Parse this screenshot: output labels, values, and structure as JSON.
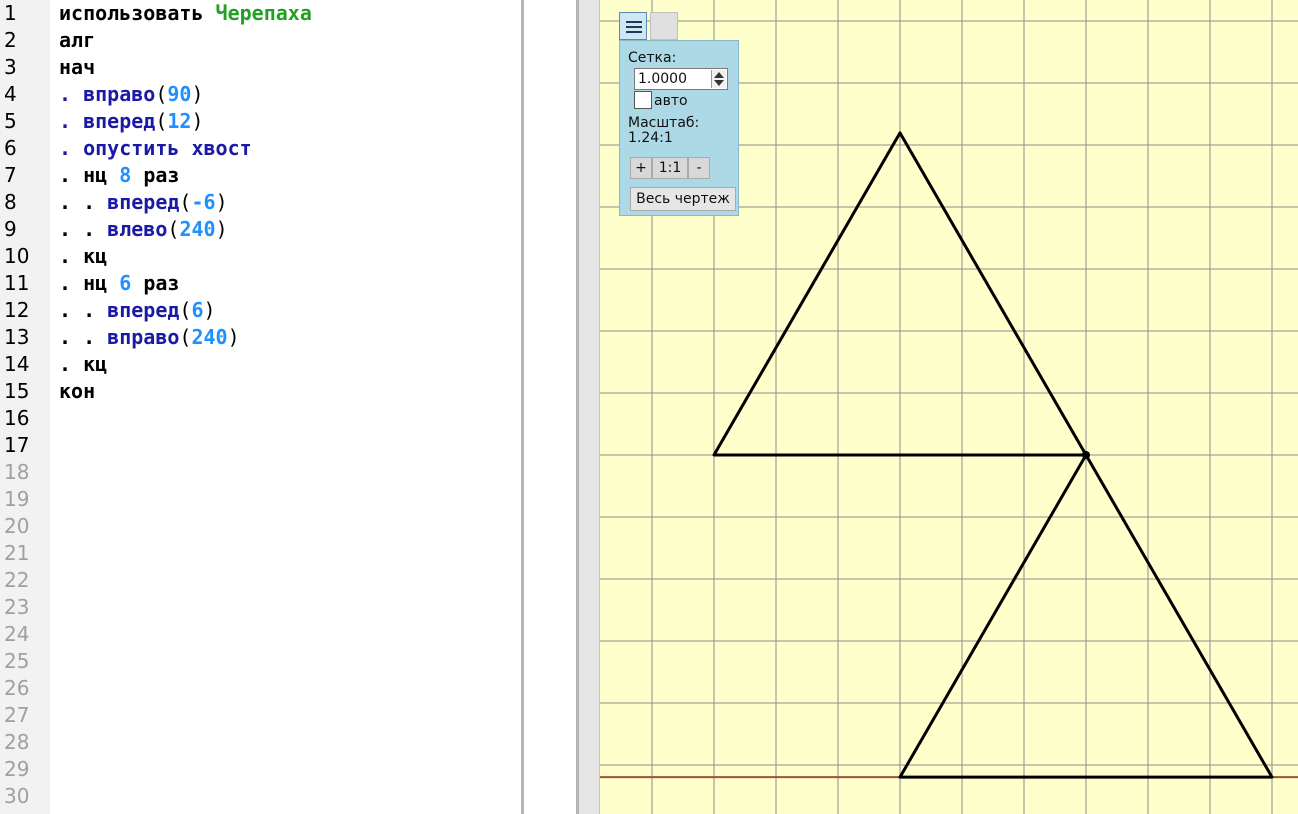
{
  "editor": {
    "line_numbers": [
      "1",
      "2",
      "3",
      "4",
      "5",
      "6",
      "7",
      "8",
      "9",
      "10",
      "11",
      "12",
      "13",
      "14",
      "15",
      "16",
      "17",
      "18",
      "19",
      "20",
      "21",
      "22",
      "23",
      "24",
      "25",
      "26",
      "27",
      "28",
      "29",
      "30"
    ],
    "code": {
      "l1_kw": "использовать",
      "l1_mod": "Черепаха",
      "l2": "алг",
      "l3": "нач",
      "l4_fn": ". вправо",
      "l4_open": "(",
      "l4_num": "90",
      "l4_close": ")",
      "l5_fn": ". вперед",
      "l5_open": "(",
      "l5_num": "12",
      "l5_close": ")",
      "l6_fn": ". опустить хвост",
      "l7_kw": ". нц",
      "l7_num": "8",
      "l7_kw2": "раз",
      "l8_dots": ". .",
      "l8_fn": "вперед",
      "l8_open": "(",
      "l8_num": "-6",
      "l8_close": ")",
      "l9_dots": ". .",
      "l9_fn": "влево",
      "l9_open": "(",
      "l9_num": "240",
      "l9_close": ")",
      "l10": ". кц",
      "l11_kw": ". нц",
      "l11_num": "6",
      "l11_kw2": "раз",
      "l12_dots": ". .",
      "l12_fn": "вперед",
      "l12_open": "(",
      "l12_num": "6",
      "l12_close": ")",
      "l13_dots": ". .",
      "l13_fn": "вправо",
      "l13_open": "(",
      "l13_num": "240",
      "l13_close": ")",
      "l14": ". кц",
      "l15": "кон"
    }
  },
  "panel": {
    "grid_label": "Сетка:",
    "grid_value": "1.0000",
    "auto_label": "авто",
    "auto_checked": false,
    "scale_label": "Масштаб:",
    "scale_value": "1.24:1",
    "zoom_in": "+",
    "zoom_reset": "1:1",
    "zoom_out": "-",
    "whole_drawing": "Весь чертеж"
  },
  "drawing": {
    "grid_step": 1,
    "triangles": [
      [
        [
          0,
          0
        ],
        [
          6,
          0
        ],
        [
          3,
          5.196
        ]
      ],
      [
        [
          3,
          -5.196
        ],
        [
          9,
          -5.196
        ],
        [
          6,
          0
        ]
      ]
    ],
    "turtle_position": [
      6,
      0
    ],
    "colors": {
      "background": "#ffffcc",
      "grid": "#8c8c8c",
      "line": "#000000",
      "axis": "#a0522d"
    }
  }
}
